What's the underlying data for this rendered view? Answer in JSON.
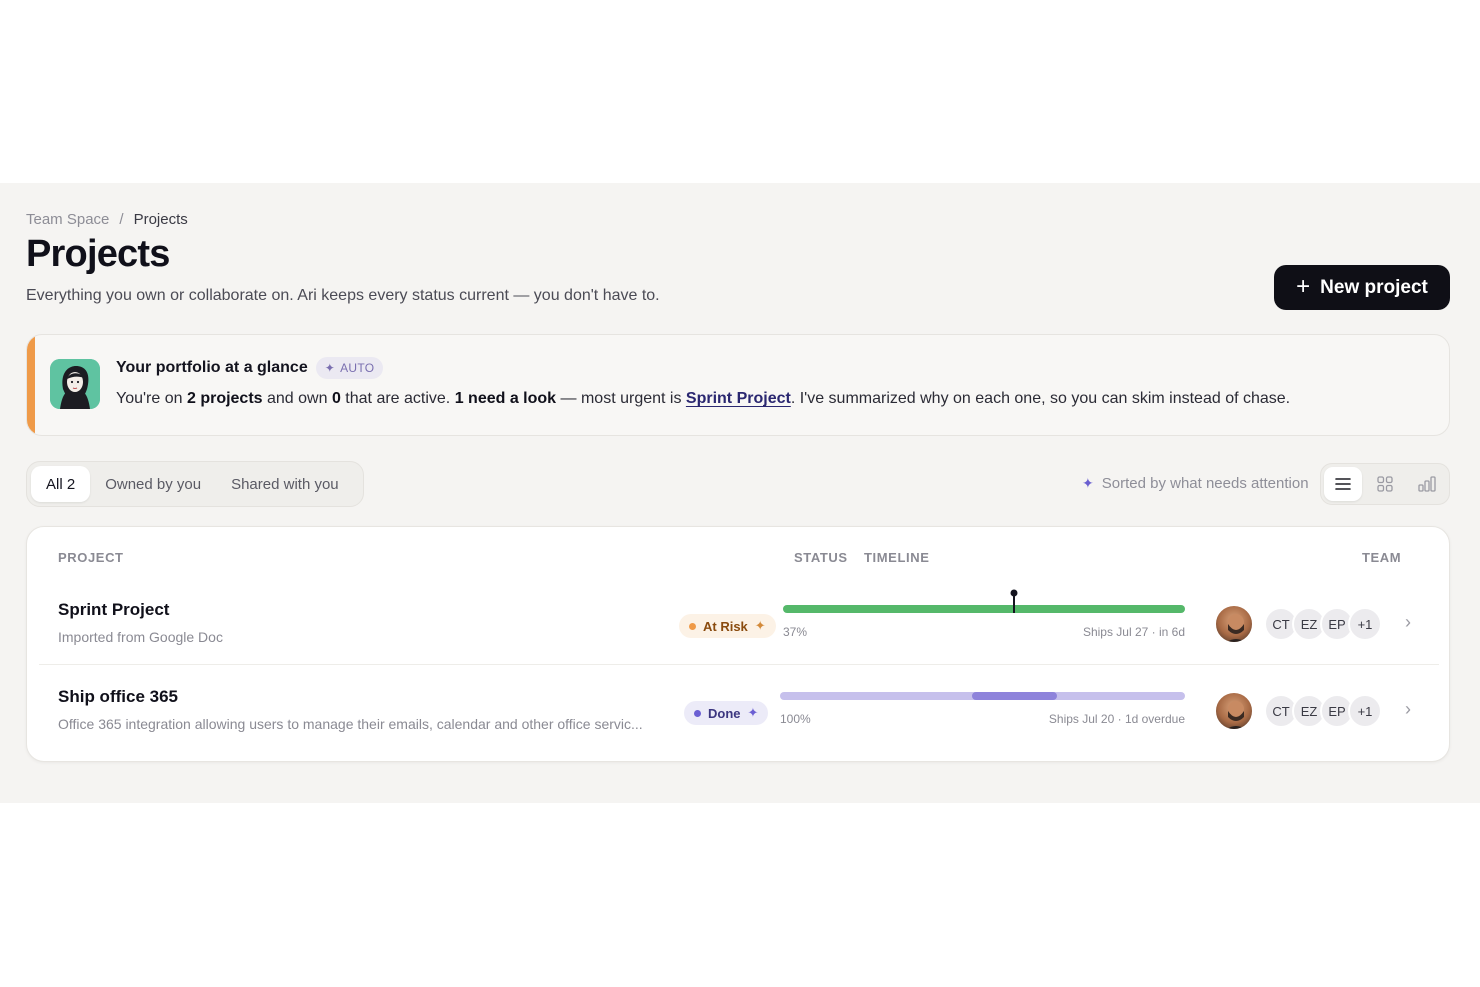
{
  "breadcrumb": {
    "root": "Team Space",
    "separator": "/",
    "current": "Projects"
  },
  "page": {
    "title": "Projects",
    "subtitle": "Everything you own or collaborate on. Ari keeps every status current — you don't have to."
  },
  "new_button": {
    "label": "New project",
    "icon": "plus-icon"
  },
  "summary": {
    "title": "Your portfolio at a glance",
    "badge": "AUTO",
    "text_1": "You're on ",
    "projects_count": "2 projects",
    "text_2": " and own ",
    "owned": "0",
    "text_3": " that are active. ",
    "needs": "1 need a look",
    "text_4": " — most urgent is ",
    "urgent_link": "Sprint Project",
    "text_5": ". I've summarized why on each one, so you can skim instead of chase."
  },
  "filters": {
    "tabs": [
      {
        "label": "All 2",
        "active": true
      },
      {
        "label": "Owned by you",
        "active": false
      },
      {
        "label": "Shared with you",
        "active": false
      }
    ]
  },
  "sort": {
    "label": "Sorted by what needs attention"
  },
  "views": [
    "list-icon",
    "grid-icon",
    "chart-icon"
  ],
  "table": {
    "headers": {
      "project": "PROJECT",
      "status": "STATUS",
      "timeline": "TIMELINE",
      "team": "TEAM"
    },
    "rows": [
      {
        "name": "Sprint Project",
        "description": "Imported from Google Doc",
        "status": "At Risk",
        "status_color": "#ef9a48",
        "progress": 37,
        "progress_label": "37%",
        "ships": "Ships Jul 27 · in 6d",
        "team": [
          "CT",
          "EZ",
          "EP",
          "+1"
        ]
      },
      {
        "name": "Ship office 365",
        "description": "Office 365 integration allowing users to manage their emails, calendar and other office servic...",
        "status": "Done",
        "status_color": "#6b5fd3",
        "progress": 100,
        "progress_label": "100%",
        "ships": "Ships Jul 20 · 1d overdue",
        "team": [
          "CT",
          "EZ",
          "EP",
          "+1"
        ]
      }
    ]
  }
}
